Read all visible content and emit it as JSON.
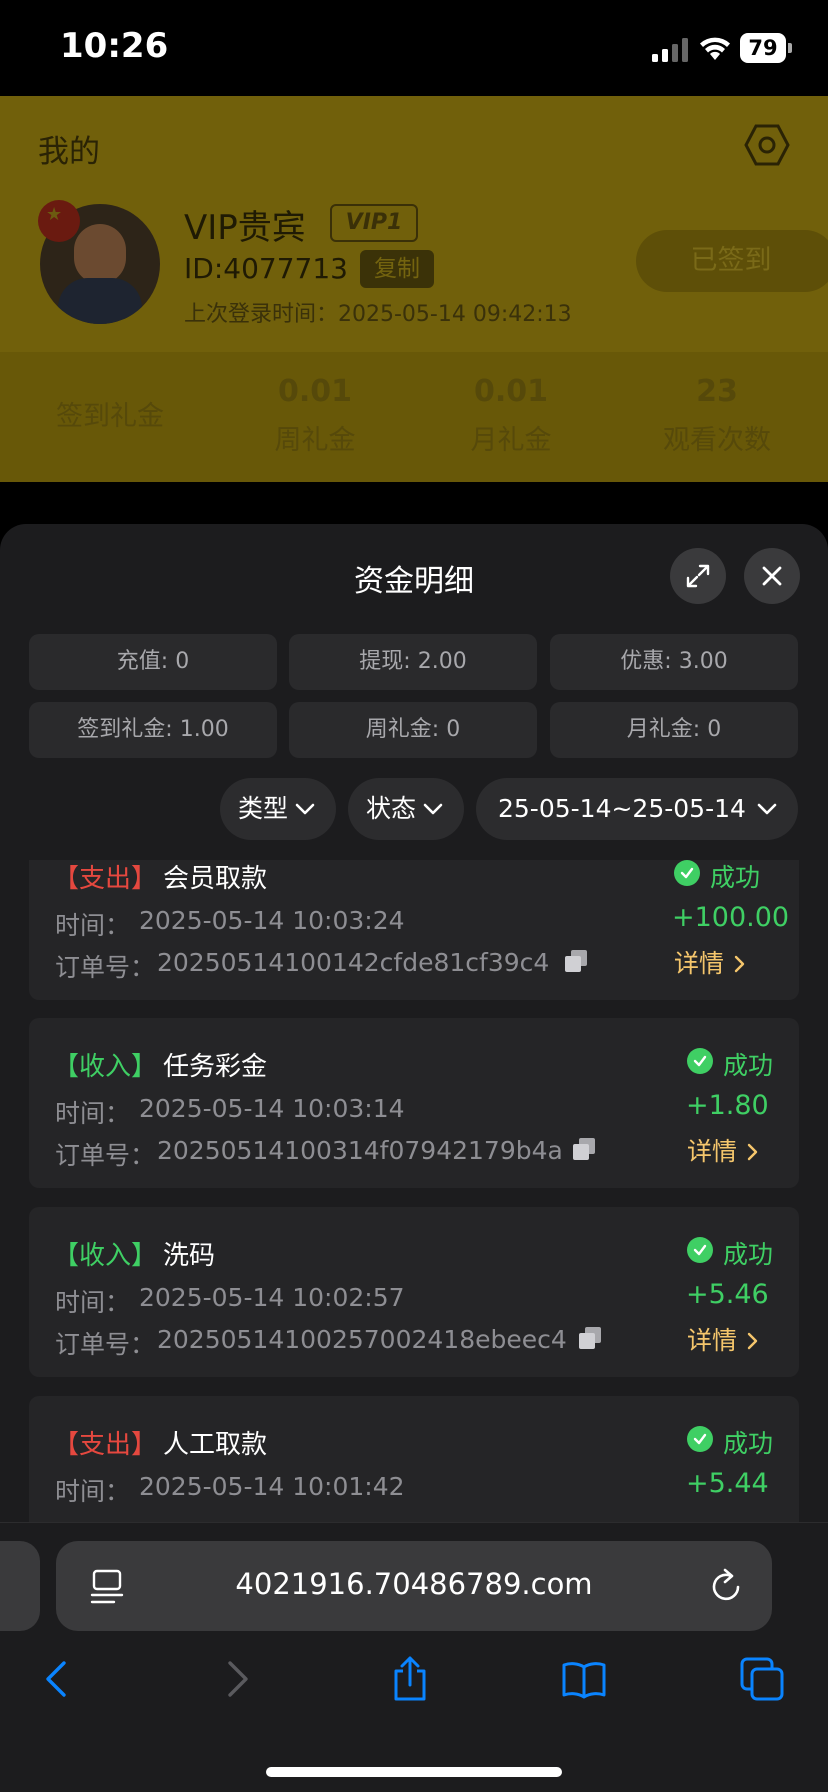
{
  "status_bar": {
    "time": "10:26",
    "battery": "79"
  },
  "background_page": {
    "title": "我的",
    "user": {
      "name": "VIP贵宾",
      "vip_badge": "VIP1",
      "id": "ID:4077713",
      "copy_label": "复制",
      "last_login": "上次登录时间：2025-05-14 09:42:13"
    },
    "signed_button": "已签到",
    "stats": [
      {
        "value": "",
        "label": "签到礼金"
      },
      {
        "value": "0.01",
        "label": "周礼金"
      },
      {
        "value": "0.01",
        "label": "月礼金"
      },
      {
        "value": "23",
        "label": "观看次数"
      }
    ]
  },
  "sheet": {
    "title": "资金明细",
    "summary": [
      "充值: 0",
      "提现: 2.00",
      "优惠: 3.00",
      "签到礼金: 1.00",
      "周礼金: 0",
      "月礼金: 0"
    ],
    "filters": {
      "type": "类型",
      "status": "状态",
      "date_range": "25-05-14~25-05-14"
    },
    "time_label": "时间：",
    "order_label": "订单号：",
    "detail_label": "详情",
    "transactions": [
      {
        "tag": "【支出】",
        "kind": "out",
        "title": "会员取款",
        "time": "2025-05-14 10:03:24",
        "order": "20250514100142cfde81cf39c4",
        "status": "成功",
        "amount": "+100.00"
      },
      {
        "tag": "【收入】",
        "kind": "in",
        "title": "任务彩金",
        "time": "2025-05-14 10:03:14",
        "order": "20250514100314f07942179b4a",
        "status": "成功",
        "amount": "+1.80"
      },
      {
        "tag": "【收入】",
        "kind": "in",
        "title": "洗码",
        "time": "2025-05-14 10:02:57",
        "order": "20250514100257002418ebeec4",
        "status": "成功",
        "amount": "+5.46"
      },
      {
        "tag": "【支出】",
        "kind": "out",
        "title": "人工取款",
        "time": "2025-05-14 10:01:42",
        "order": "",
        "status": "成功",
        "amount": "+5.44"
      }
    ]
  },
  "browser": {
    "url": "4021916.70486789.com"
  },
  "colors": {
    "income": "#3fcf64",
    "expense": "#e5483f",
    "detail": "#f5c66c",
    "sheet_bg": "#1c1c1e"
  }
}
